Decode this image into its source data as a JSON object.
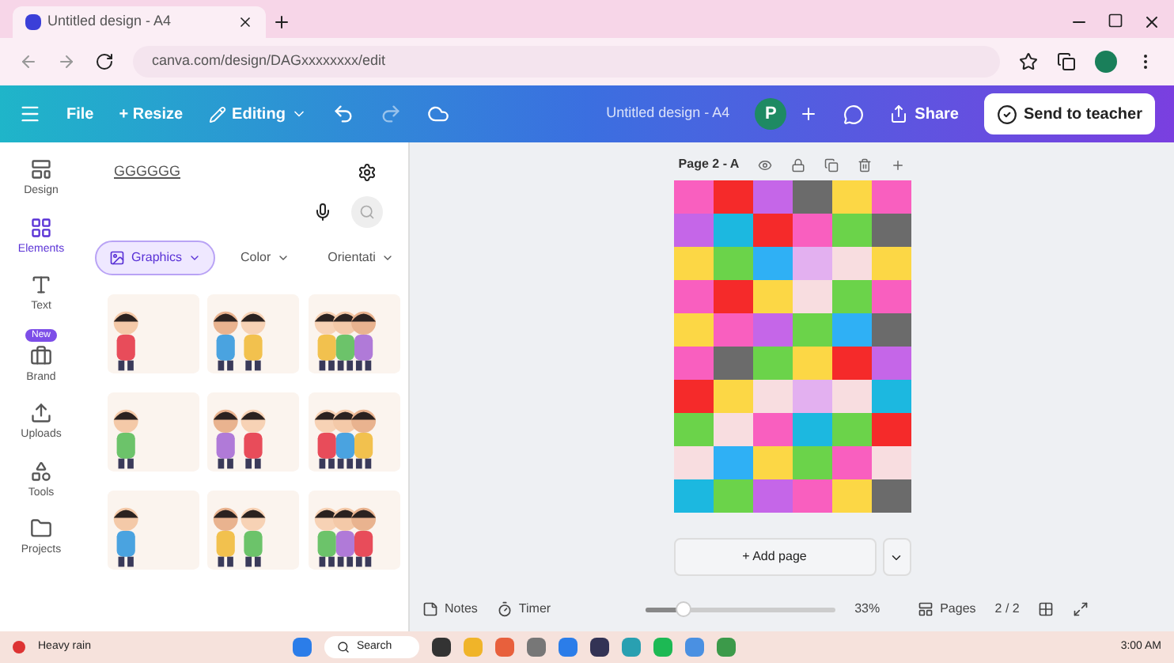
{
  "browser": {
    "tab_title": "Untitled design - A4",
    "url": "canva.com/design/DAGxxxxxxxx/edit"
  },
  "toolbar": {
    "items": [
      {
        "kind": "menu"
      },
      {
        "kind": "text",
        "label": "File"
      },
      {
        "kind": "text",
        "label": "+ Resize"
      },
      {
        "kind": "editing",
        "label": "Editing"
      }
    ],
    "design_title": "Untitled design - A4",
    "avatar": "P",
    "share": "Share",
    "send": "Send to teacher"
  },
  "rail": [
    {
      "label": "Design",
      "selected": false
    },
    {
      "label": "Elements",
      "selected": true
    },
    {
      "label": "Text",
      "selected": false
    },
    {
      "label": "Brand",
      "selected": false,
      "badge": "New"
    },
    {
      "label": "Uploads",
      "selected": false
    },
    {
      "label": "Tools",
      "selected": false
    },
    {
      "label": "Projects",
      "selected": false
    }
  ],
  "panel": {
    "search_value": "GGGGGG",
    "filters": [
      {
        "label": "Graphics",
        "selected": true
      },
      {
        "label": "Color",
        "selected": false
      },
      {
        "label": "Orientati",
        "selected": false
      }
    ]
  },
  "page": {
    "label": "Page 2 - A",
    "rows": [
      {
        "cells": [
          {
            "color": "#f95fbf"
          },
          {
            "color": "#f52a2a"
          },
          {
            "color": "#c566e8"
          },
          {
            "color": "#6b6b6b"
          },
          {
            "color": "#fcd745"
          },
          {
            "color": "#f95fbf"
          }
        ]
      },
      {
        "cells": [
          {
            "color": "#c566e8"
          },
          {
            "color": "#1cb8e0"
          },
          {
            "color": "#f52a2a"
          },
          {
            "color": "#f95fbf"
          },
          {
            "color": "#6bd34a"
          },
          {
            "color": "#6b6b6b"
          }
        ]
      },
      {
        "cells": [
          {
            "color": "#fcd745"
          },
          {
            "color": "#6bd34a"
          },
          {
            "color": "#2fb0f5"
          },
          {
            "color": "#e3b0f0"
          },
          {
            "color": "#f8dde0"
          },
          {
            "color": "#fcd745"
          }
        ]
      },
      {
        "cells": [
          {
            "color": "#f95fbf"
          },
          {
            "color": "#f52a2a"
          },
          {
            "color": "#fcd745"
          },
          {
            "color": "#f8dde0"
          },
          {
            "color": "#6bd34a"
          },
          {
            "color": "#f95fbf"
          }
        ]
      },
      {
        "cells": [
          {
            "color": "#fcd745"
          },
          {
            "color": "#f95fbf"
          },
          {
            "color": "#c566e8"
          },
          {
            "color": "#6bd34a"
          },
          {
            "color": "#2fb0f5"
          },
          {
            "color": "#6b6b6b"
          }
        ]
      },
      {
        "cells": [
          {
            "color": "#f95fbf"
          },
          {
            "color": "#6b6b6b"
          },
          {
            "color": "#6bd34a"
          },
          {
            "color": "#fcd745"
          },
          {
            "color": "#f52a2a"
          },
          {
            "color": "#c566e8"
          }
        ]
      },
      {
        "cells": [
          {
            "color": "#f52a2a"
          },
          {
            "color": "#fcd745"
          },
          {
            "color": "#f8dde0"
          },
          {
            "color": "#e3b0f0"
          },
          {
            "color": "#f8dde0"
          },
          {
            "color": "#1cb8e0"
          }
        ]
      },
      {
        "cells": [
          {
            "color": "#6bd34a"
          },
          {
            "color": "#f8dde0"
          },
          {
            "color": "#f95fbf"
          },
          {
            "color": "#1cb8e0"
          },
          {
            "color": "#6bd34a"
          },
          {
            "color": "#f52a2a"
          }
        ]
      },
      {
        "cells": [
          {
            "color": "#f8dde0"
          },
          {
            "color": "#2fb0f5"
          },
          {
            "color": "#fcd745"
          },
          {
            "color": "#6bd34a"
          },
          {
            "color": "#f95fbf"
          },
          {
            "color": "#f8dde0"
          }
        ]
      },
      {
        "cells": [
          {
            "color": "#1cb8e0"
          },
          {
            "color": "#6bd34a"
          },
          {
            "color": "#c566e8"
          },
          {
            "color": "#f95fbf"
          },
          {
            "color": "#fcd745"
          },
          {
            "color": "#6b6b6b"
          }
        ]
      }
    ],
    "add_page": "+ Add page"
  },
  "footer": {
    "notes": "Notes",
    "timer": "Timer",
    "zoom": {
      "level": 0.2,
      "reading": "33%"
    },
    "pages": "Pages",
    "page_count": "2 / 2"
  },
  "taskbar": {
    "weather": "Heavy rain",
    "search": "Search",
    "time": "3:00 AM"
  }
}
